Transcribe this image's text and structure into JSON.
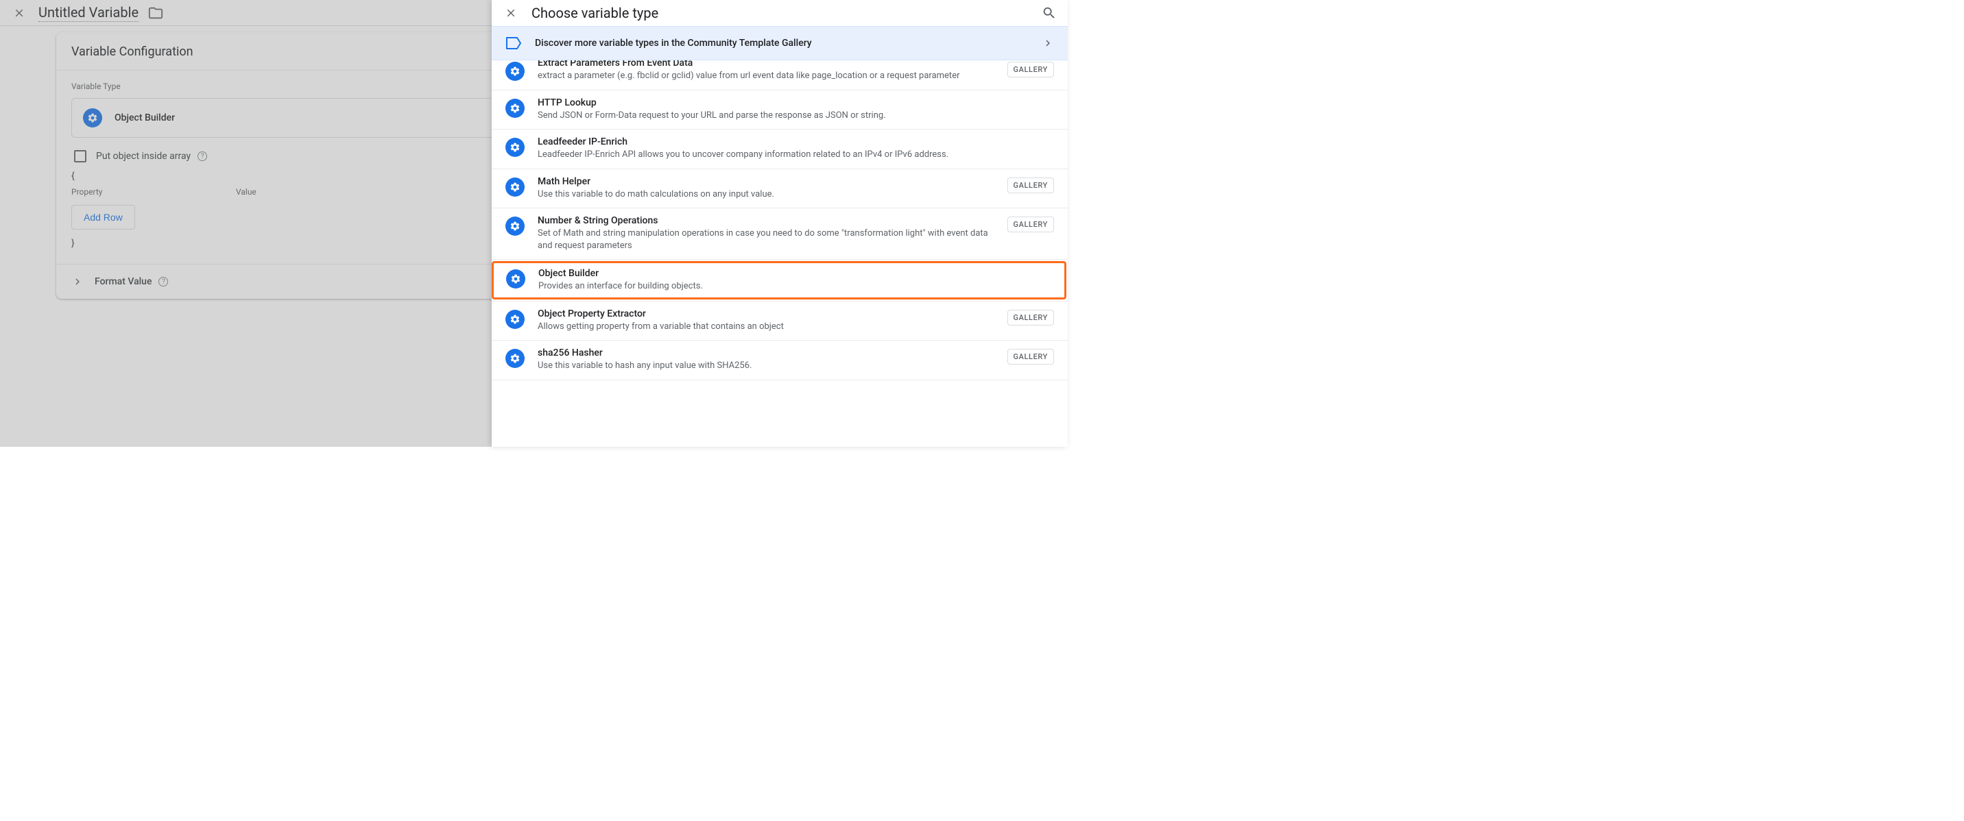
{
  "main": {
    "title": "Untitled Variable",
    "card_title": "Variable Configuration",
    "type_label": "Variable Type",
    "selected_type": "Object Builder",
    "checkbox_label": "Put object inside array",
    "brace_open": "{",
    "brace_close": "}",
    "col_property": "Property",
    "col_value": "Value",
    "add_row": "Add Row",
    "format_value": "Format Value"
  },
  "drawer": {
    "title": "Choose variable type",
    "banner": "Discover more variable types in the Community Template Gallery",
    "gallery_label": "GALLERY",
    "items": [
      {
        "title": "Extract Parameters From Event Data",
        "desc": "extract a parameter (e.g. fbclid or gclid) value from url event data like page_location or a request parameter",
        "gallery": true,
        "partial": true
      },
      {
        "title": "HTTP Lookup",
        "desc": "Send JSON or Form-Data request to your URL and parse the response as JSON or string.",
        "gallery": false
      },
      {
        "title": "Leadfeeder IP-Enrich",
        "desc": "Leadfeeder IP-Enrich API allows you to uncover company information related to an IPv4 or IPv6 address.",
        "gallery": false
      },
      {
        "title": "Math Helper",
        "desc": "Use this variable to do math calculations on any input value.",
        "gallery": true
      },
      {
        "title": "Number & String Operations",
        "desc": "Set of Math and string manipulation operations in case you need to do some \"transformation light\" with event data and request parameters",
        "gallery": true
      },
      {
        "title": "Object Builder",
        "desc": "Provides an interface for building objects.",
        "gallery": false,
        "highlight": true
      },
      {
        "title": "Object Property Extractor",
        "desc": "Allows getting property from a variable that contains an object",
        "gallery": true
      },
      {
        "title": "sha256 Hasher",
        "desc": "Use this variable to hash any input value with SHA256.",
        "gallery": true
      }
    ]
  }
}
